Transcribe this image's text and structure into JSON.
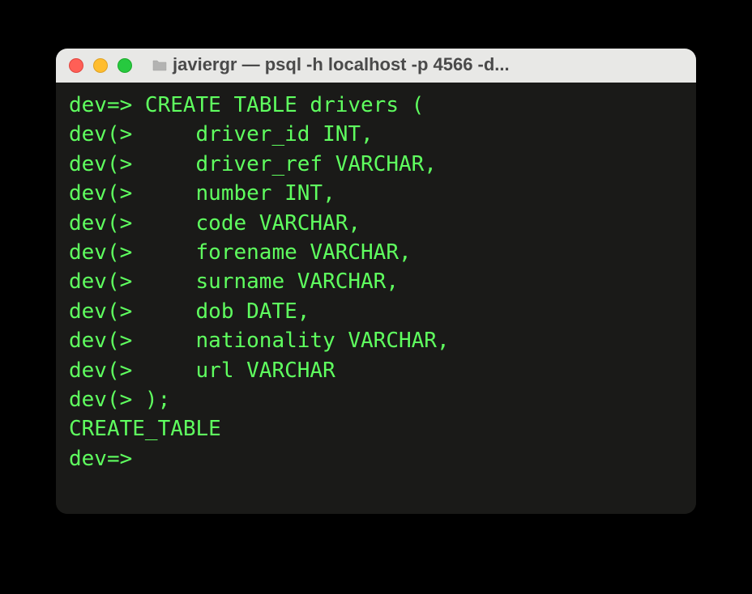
{
  "window": {
    "title": "javiergr — psql -h localhost -p 4566 -d..."
  },
  "terminal": {
    "lines": [
      "dev=> CREATE TABLE drivers (",
      "dev(>     driver_id INT,",
      "dev(>     driver_ref VARCHAR,",
      "dev(>     number INT,",
      "dev(>     code VARCHAR,",
      "dev(>     forename VARCHAR,",
      "dev(>     surname VARCHAR,",
      "dev(>     dob DATE,",
      "dev(>     nationality VARCHAR,",
      "dev(>     url VARCHAR",
      "dev(> );",
      "CREATE_TABLE",
      "dev=>"
    ]
  }
}
